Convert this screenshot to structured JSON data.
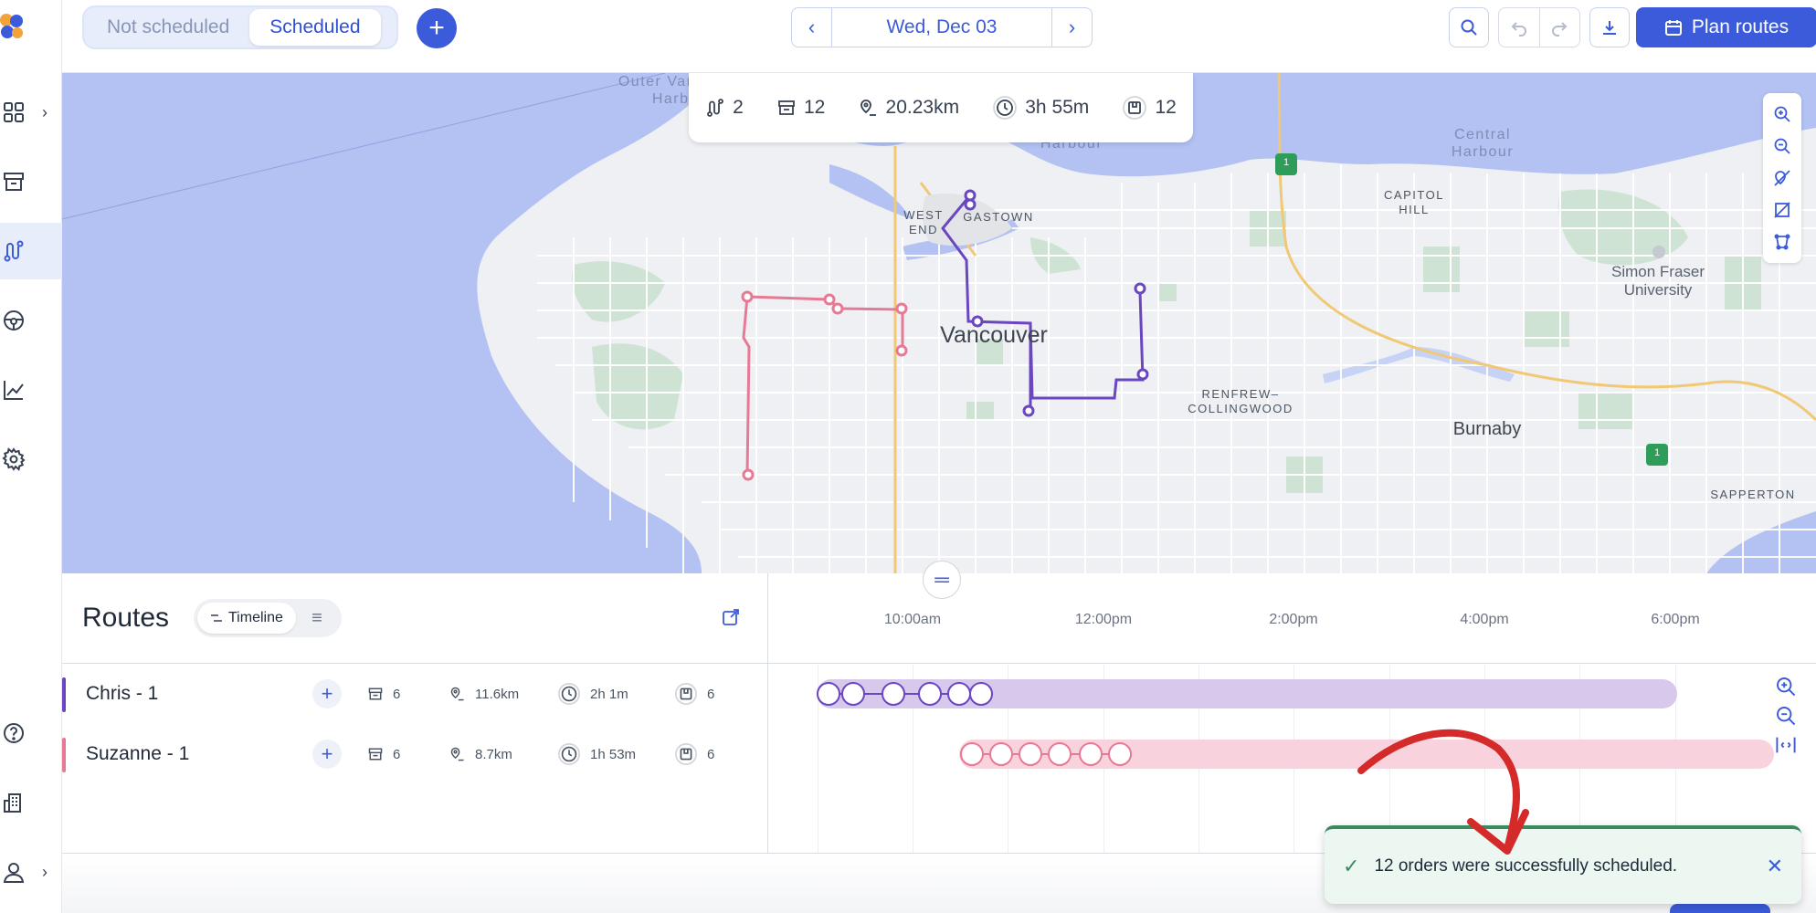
{
  "topbar": {
    "tab_not_scheduled": "Not scheduled",
    "tab_scheduled": "Scheduled",
    "date": "Wed, Dec 03",
    "plan_routes": "Plan routes"
  },
  "summary": {
    "routes": "2",
    "stops": "12",
    "distance": "20.23km",
    "duration": "3h 55m",
    "orders": "12"
  },
  "map": {
    "labels": {
      "outer_harbour": "Outer Vancouver Harbour",
      "central_harbour": "Central Harbour",
      "harbour": "Harbour",
      "west_end": "WEST END",
      "gastown": "GASTOWN",
      "capitol_hill": "CAPITOL HILL",
      "vancouver": "Vancouver",
      "renfrew": "RENFREW–COLLINGWOOD",
      "burnaby": "Burnaby",
      "sfu": "Simon Fraser University",
      "sapperton": "SAPPERTON",
      "hwy1": "1"
    }
  },
  "panel": {
    "title": "Routes",
    "view_timeline": "Timeline",
    "times": [
      "10:00am",
      "12:00pm",
      "2:00pm",
      "4:00pm",
      "6:00pm"
    ]
  },
  "routes": [
    {
      "name": "Chris - 1",
      "stops": "6",
      "distance": "11.6km",
      "duration": "2h 1m",
      "orders": "6",
      "color": "#6b46c1",
      "track_color": "#d7c9ec"
    },
    {
      "name": "Suzanne - 1",
      "stops": "6",
      "distance": "8.7km",
      "duration": "1h 53m",
      "orders": "6",
      "color": "#e67a95",
      "track_color": "#f8d3dd"
    }
  ],
  "toast": {
    "message": "12 orders were successfully scheduled."
  },
  "colors": {
    "accent": "#3b5bdb",
    "water": "#b3c2f2",
    "success": "#3a8a61"
  }
}
